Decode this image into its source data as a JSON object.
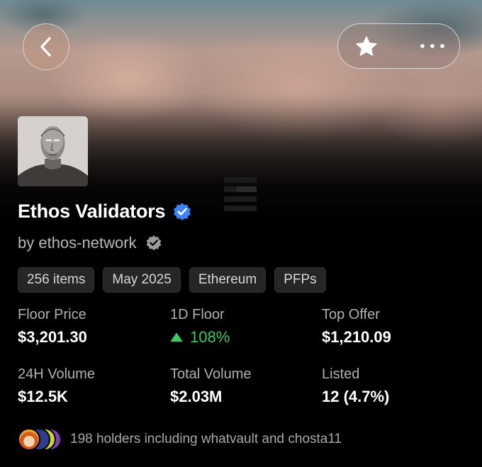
{
  "header": {
    "back_icon": "chevron-left-icon",
    "favorite_icon": "star-icon",
    "more_icon": "more-horizontal-icon"
  },
  "collection": {
    "name": "Ethos Validators",
    "verified_icon": "verified-badge-icon",
    "creator": "by ethos-network",
    "creator_badge_icon": "verified-badge-icon",
    "logo": "ethos-logo"
  },
  "tags": [
    "256 items",
    "May 2025",
    "Ethereum",
    "PFPs"
  ],
  "stats": {
    "floor_price": {
      "label": "Floor Price",
      "value": "$3,201.30"
    },
    "floor_1d": {
      "label": "1D Floor",
      "value": "108%",
      "direction": "up"
    },
    "top_offer": {
      "label": "Top Offer",
      "value": "$1,210.09"
    },
    "volume_24h": {
      "label": "24H Volume",
      "value": "$12.5K"
    },
    "total_volume": {
      "label": "Total Volume",
      "value": "$2.03M"
    },
    "listed": {
      "label": "Listed",
      "value": "12 (4.7%)"
    }
  },
  "holders": {
    "text": "198 holders including whatvault and chosta11"
  },
  "colors": {
    "accent_green": "#3ec95f",
    "verified_blue": "#3b82f6",
    "chip_bg": "#262626"
  }
}
